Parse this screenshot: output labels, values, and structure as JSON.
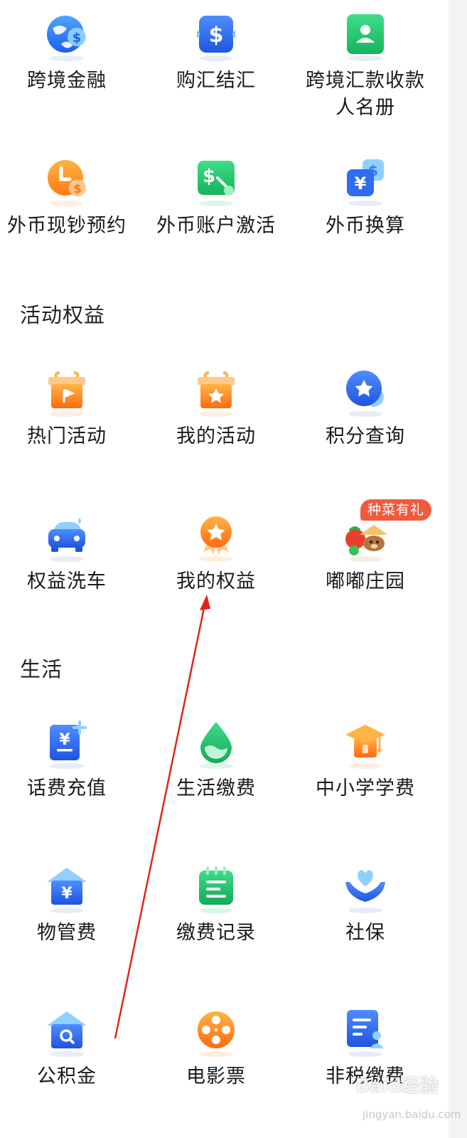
{
  "sections": {
    "activities": "活动权益",
    "life": "生活"
  },
  "items": {
    "cross_border_finance": "跨境金融",
    "buy_settle_fx": "购汇结汇",
    "cross_border_payee_line1": "跨境汇款收款",
    "cross_border_payee_line2": "人名册",
    "fx_cash_reservation": "外币现钞预约",
    "fx_account_activation": "外币账户激活",
    "fx_conversion": "外币换算",
    "hot_activities": "热门活动",
    "my_activities": "我的活动",
    "points_query": "积分查询",
    "car_wash": "权益洗车",
    "my_benefits": "我的权益",
    "dudu_farm": "嘟嘟庄园",
    "phone_recharge": "话费充值",
    "utility_payment": "生活缴费",
    "school_fees": "中小学学费",
    "property_fee": "物管费",
    "payment_records": "缴费记录",
    "social_security": "社保",
    "housing_fund": "公积金",
    "movie_tickets": "电影票",
    "non_tax_payment": "非税缴费"
  },
  "badge": "种菜有礼",
  "watermark": {
    "text": "Baid经验",
    "url": "jingyan.baidu.com"
  },
  "colors": {
    "blue": "#2f7cf6",
    "green": "#22c36b",
    "orange": "#ff8a1e",
    "badge": "#f25a3c",
    "arrow": "#e0241b"
  },
  "icons": [
    "globe-dollar-icon",
    "dollar-exchange-icon",
    "contact-book-icon",
    "clock-dollar-icon",
    "dollar-key-icon",
    "yen-dollar-icon",
    "gift-flag-icon",
    "gift-star-icon",
    "star-circle-icon",
    "car-icon",
    "medal-icon",
    "farm-icon",
    "yen-card-plus-icon",
    "water-drop-icon",
    "graduation-cap-icon",
    "house-yen-icon",
    "calendar-list-icon",
    "heart-hands-icon",
    "house-search-icon",
    "film-reel-icon",
    "document-person-icon"
  ]
}
